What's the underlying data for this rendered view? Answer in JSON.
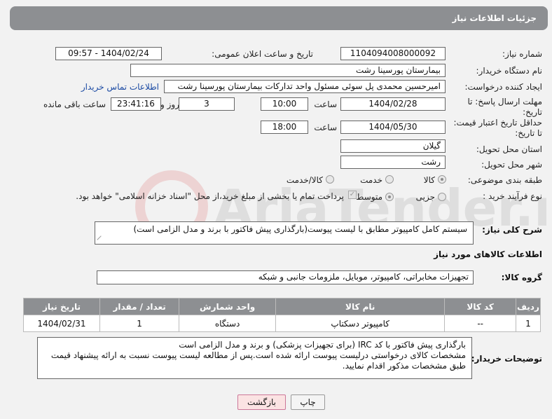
{
  "header": {
    "title": "جزئیات اطلاعات نیاز"
  },
  "labels": {
    "need_number": "شماره نیاز:",
    "announce_datetime": "تاریخ و ساعت اعلان عمومی:",
    "buyer_org": "نام دستگاه خریدار:",
    "requester": "ایجاد کننده درخواست:",
    "deadline_line1": "مهلت ارسال پاسخ: تا",
    "deadline_line2": "تاریخ:",
    "min_validity_line1": "حداقل تاریخ اعتبار قیمت:",
    "min_validity_line2": "تا تاریخ:",
    "delivery_province": "استان محل تحویل:",
    "delivery_city": "شهر محل تحویل:",
    "category": "طبقه بندی موضوعی:",
    "process_type": "نوع فرآیند خرید :",
    "time_label": "ساعت",
    "time_label2": "ساعت",
    "days_and": "روز و",
    "hours_remaining": "ساعت باقی مانده",
    "general_desc": "شرح کلی نیاز:",
    "items_info": "اطلاعات کالاهای مورد نیاز",
    "goods_group": "گروه کالا:",
    "buyer_notes": "توضیحات خریدار:"
  },
  "fields": {
    "need_number": "1104094008000092",
    "announce_datetime": "1404/02/24 - 09:57",
    "buyer_org": "بیمارستان پورسینا رشت",
    "requester": "امیرحسین محمدی پل سوئی مسئول واحد تدارکات بیمارستان پورسینا رشت",
    "buyer_contact_link": "اطلاعات تماس خریدار",
    "deadline_date": "1404/02/28",
    "deadline_time": "10:00",
    "deadline_days": "3",
    "remaining_time": "23:41:16",
    "validity_date": "1404/05/30",
    "validity_time": "18:00",
    "province": "گیلان",
    "city": "رشت",
    "general_desc": "سیستم کامل کامپیوتر مطابق با لیست پیوست(بارگذاری پیش فاکتور با برند و مدل الزامی است)",
    "goods_group": "تجهیزات مخابراتی، کامپیوتر، موبایل، ملزومات جانبی و شبکه",
    "buyer_notes": "بارگذاری پیش فاکتور با کد IRC (برای تجهیزات پزشکی) و برند و مدل الزامی است\nمشخصات کالای درخواستی درلیست پیوست ارائه شده است.پس از مطالعه لیست پیوست نسبت به ارائه پیشنهاد قیمت طبق مشخصات مذکور اقدام نمایید."
  },
  "category_options": [
    {
      "label": "کالا",
      "selected": true
    },
    {
      "label": "خدمت",
      "selected": false
    },
    {
      "label": "کالا/خدمت",
      "selected": false
    }
  ],
  "process_options": [
    {
      "label": "جزیی",
      "selected": false
    },
    {
      "label": "متوسط",
      "selected": true
    }
  ],
  "process_note": "پرداخت تمام یا بخشی از مبلغ خرید،از محل \"اسناد خزانه اسلامی\" خواهد بود.",
  "table": {
    "headers": [
      "ردیف",
      "کد کالا",
      "نام کالا",
      "واحد شمارش",
      "تعداد / مقدار",
      "تاریخ نیاز"
    ],
    "rows": [
      [
        "1",
        "--",
        "کامپیوتر دسکتاپ",
        "دستگاه",
        "1",
        "1404/02/31"
      ]
    ]
  },
  "buttons": {
    "print": "چاپ",
    "back": "بازگشت"
  },
  "watermark": {
    "text": "AriaTender.neT"
  }
}
